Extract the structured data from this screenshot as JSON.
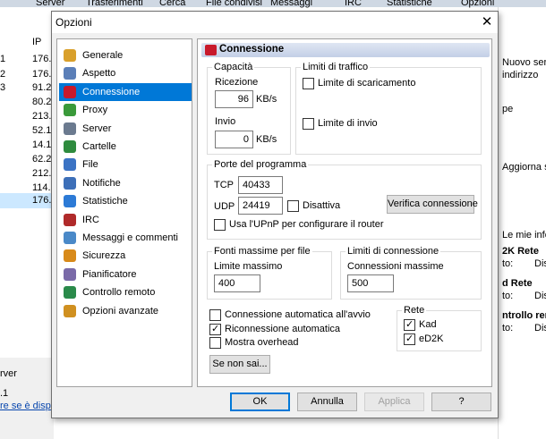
{
  "background": {
    "top_tabs": [
      "Server",
      "Trasferimenti",
      "Cerca",
      "File condivisi",
      "Messaggi",
      "IRC",
      "Statistiche",
      "Opzioni"
    ],
    "left_list": {
      "ip_header": "IP",
      "rows": [
        {
          "a": "1",
          "b": "176."
        },
        {
          "a": "2",
          "b": "176."
        },
        {
          "a": "3",
          "b": "91.2"
        },
        {
          "a": "",
          "b": "80.2"
        },
        {
          "a": "",
          "b": "213."
        },
        {
          "a": "",
          "b": "52.1"
        },
        {
          "a": "",
          "b": "14.1"
        },
        {
          "a": "",
          "b": "62.2"
        },
        {
          "a": "",
          "b": "212."
        },
        {
          "a": "",
          "b": "114."
        },
        {
          "a": "",
          "b": "176."
        }
      ]
    },
    "left_bottom": {
      "tab": "rver",
      "line1": ".1",
      "link": "re se è disp"
    },
    "right_panel": {
      "nuovo": "Nuovo serv",
      "indirizzo": "indirizzo",
      "pe": "pe",
      "aggiorna": "Aggiorna se",
      "mie_info": "Le mie infor",
      "e2k_rete": "2K Rete",
      "e2k_sub": "to:",
      "e2k_val": "Dis",
      "d_rete": "d Rete",
      "d_sub": "to:",
      "d_val": "Dis",
      "ctrl": "ntrollo rem",
      "ctrl_sub": "to:",
      "ctrl_val": "Dis"
    }
  },
  "dialog": {
    "title": "Opzioni",
    "close_glyph": "✕",
    "nav": [
      {
        "label": "Generale",
        "icon": "gear-icon",
        "color": "#d9a02b"
      },
      {
        "label": "Aspetto",
        "icon": "monitor-icon",
        "color": "#5b7fb8"
      },
      {
        "label": "Connessione",
        "icon": "connection-icon",
        "color": "#c8192b",
        "selected": true
      },
      {
        "label": "Proxy",
        "icon": "proxy-icon",
        "color": "#3a9a3a"
      },
      {
        "label": "Server",
        "icon": "server-icon",
        "color": "#6b7a8f"
      },
      {
        "label": "Cartelle",
        "icon": "folder-icon",
        "color": "#2e8b3e"
      },
      {
        "label": "File",
        "icon": "file-icon",
        "color": "#3b73c4"
      },
      {
        "label": "Notifiche",
        "icon": "notification-icon",
        "color": "#3d6fb8"
      },
      {
        "label": "Statistiche",
        "icon": "statistics-icon",
        "color": "#2c7ad6"
      },
      {
        "label": "IRC",
        "icon": "irc-icon",
        "color": "#b02a2a"
      },
      {
        "label": "Messaggi e commenti",
        "icon": "messages-icon",
        "color": "#4a89c8"
      },
      {
        "label": "Sicurezza",
        "icon": "security-icon",
        "color": "#d88a1a"
      },
      {
        "label": "Pianificatore",
        "icon": "scheduler-icon",
        "color": "#7a6aa8"
      },
      {
        "label": "Controllo remoto",
        "icon": "remote-control-icon",
        "color": "#2a8a4a"
      },
      {
        "label": "Opzioni avanzate",
        "icon": "advanced-options-icon",
        "color": "#d09020"
      }
    ],
    "panel": {
      "title": "Connessione",
      "capacita": {
        "legend": "Capacità",
        "ricezione_label": "Ricezione",
        "ricezione_value": "96",
        "ricezione_unit": "KB/s",
        "invio_label": "Invio",
        "invio_value": "0",
        "invio_unit": "KB/s"
      },
      "limiti_traffico": {
        "legend": "Limiti di traffico",
        "scaricamento": "Limite di scaricamento",
        "invio": "Limite di invio"
      },
      "porte": {
        "legend": "Porte del programma",
        "tcp_label": "TCP",
        "tcp_value": "40433",
        "udp_label": "UDP",
        "udp_value": "24419",
        "disattiva": "Disattiva",
        "verifica": "Verifica connessione",
        "upnp": "Usa l'UPnP per configurare il router"
      },
      "fonti": {
        "legend": "Fonti massime per file",
        "label": "Limite massimo",
        "value": "400"
      },
      "limiti_conn": {
        "legend": "Limiti di connessione",
        "label": "Connessioni massime",
        "value": "500"
      },
      "options": {
        "auto_connect": "Connessione automatica all'avvio",
        "auto_reconnect": "Riconnessione automatica",
        "overhead": "Mostra overhead"
      },
      "rete": {
        "legend": "Rete",
        "kad": "Kad",
        "ed2k": "eD2K"
      },
      "help": "Se non sai..."
    },
    "buttons": {
      "ok": "OK",
      "annulla": "Annulla",
      "applica": "Applica",
      "help": "?"
    }
  }
}
